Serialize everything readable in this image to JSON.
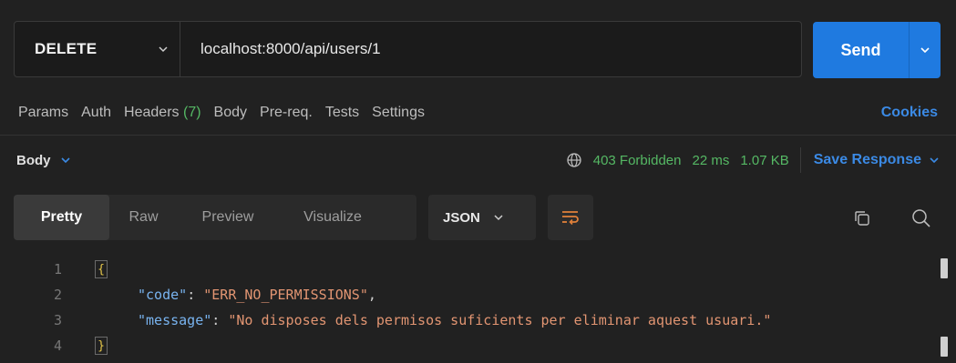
{
  "request": {
    "method": "DELETE",
    "url": "localhost:8000/api/users/1",
    "send_label": "Send"
  },
  "request_tabs": [
    {
      "label": "Params"
    },
    {
      "label": "Auth"
    },
    {
      "label": "Headers",
      "count": "(7)"
    },
    {
      "label": "Body"
    },
    {
      "label": "Pre-req."
    },
    {
      "label": "Tests"
    },
    {
      "label": "Settings"
    }
  ],
  "cookies_label": "Cookies",
  "response": {
    "body_label": "Body",
    "status": "403 Forbidden",
    "time": "22 ms",
    "size": "1.07 KB",
    "save_label": "Save Response"
  },
  "view_tabs": [
    "Pretty",
    "Raw",
    "Preview",
    "Visualize"
  ],
  "active_view": "Pretty",
  "format": "JSON",
  "code": {
    "line_numbers": [
      "1",
      "2",
      "3",
      "4"
    ],
    "open_brace": "{",
    "close_brace": "}",
    "code_key": "\"code\"",
    "code_value": "\"ERR_NO_PERMISSIONS\"",
    "message_key": "\"message\"",
    "message_value": "\"No disposes dels permisos suficients per eliminar aquest usuari.\""
  },
  "colors": {
    "accent": "#1f7ae0",
    "status_ok_text": "#55b864",
    "link": "#3b8ae5",
    "json_key": "#79b4f0",
    "json_string": "#e29572"
  }
}
